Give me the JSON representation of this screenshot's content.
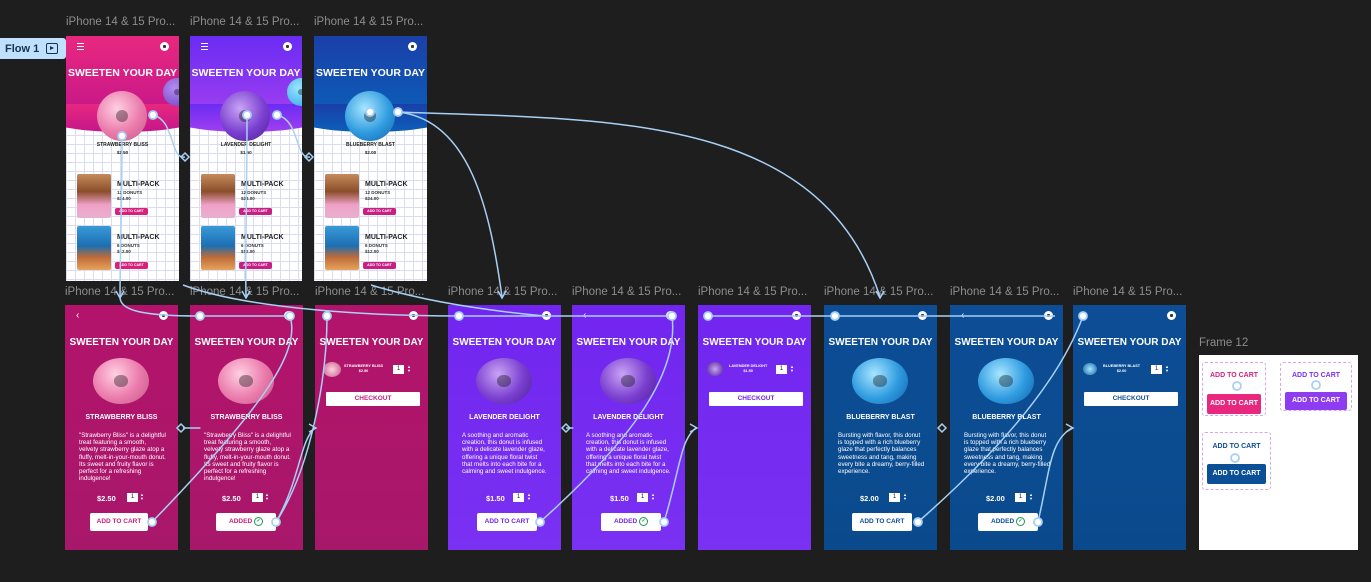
{
  "flow": {
    "label": "Flow 1"
  },
  "frame_label": "iPhone 14 & 15 Pro...",
  "frame12_label": "Frame 12",
  "colors": {
    "pink": "#d81b7a",
    "pink_dark": "#b0156a",
    "purple": "#7b2ff7",
    "purple_light": "#8e3cf2",
    "blue": "#0b4f97",
    "blue_dark": "#08467f",
    "connector": "#a8d0f5",
    "canvas": "#1e1e1e"
  },
  "common": {
    "title": "SWEETEN YOUR DAY",
    "multipack": "MULTI-PACK",
    "pack12": "12 DONUTS\n$24.00",
    "pack6": "6 DONUTS\n$12.00",
    "add_to_cart": "ADD TO CART",
    "added": "ADDED",
    "checkout": "CHECKOUT",
    "qty": "1"
  },
  "home": [
    {
      "name": "STRAWBERRY BLISS",
      "price": "$2.50"
    },
    {
      "name": "LAVENDER DELIGHT",
      "price": "$1.50"
    },
    {
      "name": "BLUEBERRY BLAST",
      "price": "$2.00"
    }
  ],
  "strawberry": {
    "name": "STRAWBERRY BLISS",
    "price": "$2.50",
    "desc": "\"Strawberry Bliss\" is a delightful treat featuring a smooth, velvety strawberry glaze atop a fluffy, melt-in-your-mouth donut. Its sweet and fruity flavor is perfect for a refreshing indulgence!",
    "cart_name": "STRAWBERRY BLISS\n$2.50"
  },
  "lavender": {
    "name": "LAVENDER DELIGHT",
    "price": "$1.50",
    "desc": "A soothing and aromatic creation, this donut is infused with a delicate lavender glaze, offering a unique floral twist that melts into each bite for a calming and sweet indulgence.",
    "cart_name": "LAVENDER DELIGHT\n$1.50"
  },
  "blueberry": {
    "name": "BLUEBERRY BLAST",
    "price": "$2.00",
    "desc": "Bursting with flavor, this donut is topped with a rich blueberry glaze that perfectly balances sweetness and tang, making every bite a dreamy, berry-filled experience.",
    "cart_name": "BLUEBERRY BLAST\n$2.00"
  },
  "frame12": {
    "pink_label": "ADD TO CART",
    "purple_label": "ADD TO CART",
    "blue_label": "ADD TO CART",
    "button": "ADD TO CART"
  }
}
